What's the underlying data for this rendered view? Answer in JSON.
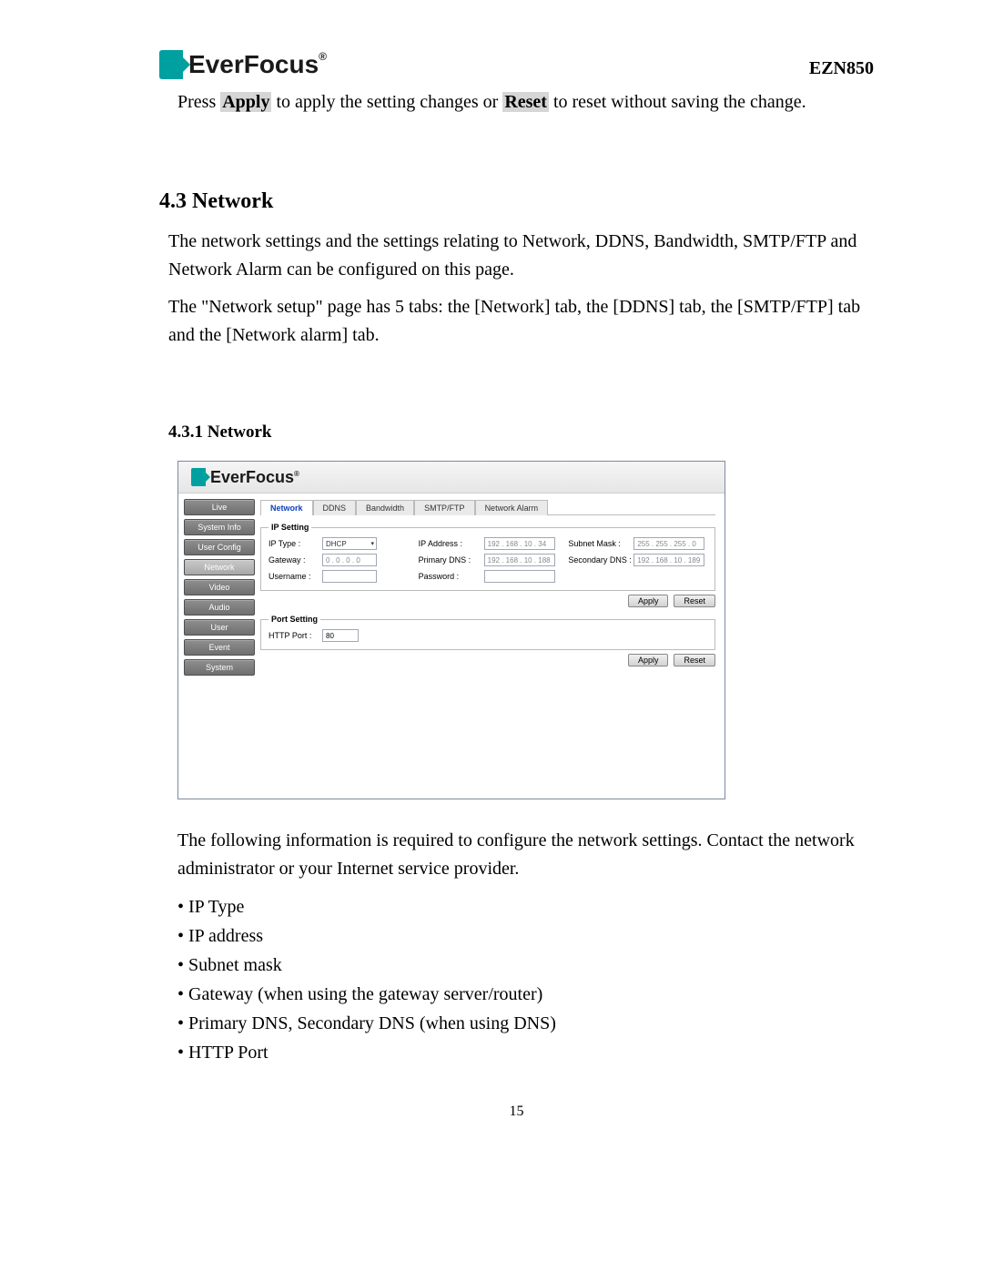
{
  "header": {
    "brand": "EverFocus",
    "reg": "®",
    "model": "EZN850"
  },
  "intro": {
    "pre": "Press ",
    "apply": "Apply",
    "mid": " to apply the setting changes or ",
    "reset": "Reset",
    "post": " to reset without saving the change."
  },
  "sec43_title": "4.3 Network",
  "sec43_p1": "The network settings and the settings relating to Network, DDNS, Bandwidth, SMTP/FTP and Network Alarm can be configured on this page.",
  "sec43_p2": "The \"Network setup\" page has 5 tabs: the [Network] tab, the [DDNS] tab, the [SMTP/FTP] tab and the [Network alarm] tab.",
  "sec431_title": "4.3.1 Network",
  "ui": {
    "brand": "EverFocus",
    "reg": "®",
    "sidebar": [
      "Live",
      "System Info",
      "User Config",
      "Network",
      "Video",
      "Audio",
      "User",
      "Event",
      "System"
    ],
    "sidebar_active_index": 3,
    "tabs": [
      "Network",
      "DDNS",
      "Bandwidth",
      "SMTP/FTP",
      "Network Alarm"
    ],
    "tabs_active_index": 0,
    "ip_setting": {
      "legend": "IP Setting",
      "ip_type_label": "IP Type :",
      "ip_type_value": "DHCP",
      "gateway_label": "Gateway :",
      "gateway_value": "0 . 0 . 0 . 0",
      "username_label": "Username :",
      "username_value": "",
      "ip_addr_label": "IP Address :",
      "ip_addr_value": "192 . 168 . 10 . 34",
      "pri_dns_label": "Primary DNS :",
      "pri_dns_value": "192 . 168 . 10 . 188",
      "password_label": "Password :",
      "password_value": "",
      "subnet_label": "Subnet Mask :",
      "subnet_value": "255 . 255 . 255 . 0",
      "sec_dns_label": "Secondary DNS :",
      "sec_dns_value": "192 . 168 . 10 . 189"
    },
    "port_setting": {
      "legend": "Port Setting",
      "http_label": "HTTP Port :",
      "http_value": "80"
    },
    "buttons": {
      "apply": "Apply",
      "reset": "Reset"
    }
  },
  "after": {
    "p": "The following information is required to configure the network settings. Contact the network administrator or your Internet service provider.",
    "bullets": [
      "IP Type",
      "IP address",
      "Subnet mask",
      "Gateway (when using the gateway server/router)",
      "Primary DNS, Secondary DNS (when using DNS)",
      "HTTP Port"
    ]
  },
  "page_number": "15"
}
